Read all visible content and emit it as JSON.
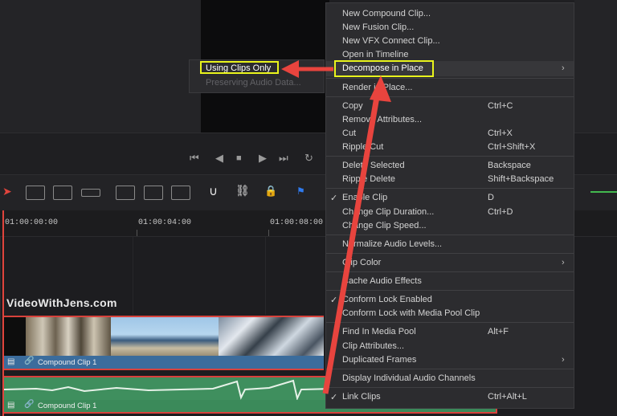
{
  "submenu": {
    "items": [
      "Using Clips Only",
      "Preserving Audio Data..."
    ]
  },
  "menu": {
    "items": [
      {
        "label": "New Compound Clip...",
        "shortcut": ""
      },
      {
        "label": "New Fusion Clip...",
        "shortcut": ""
      },
      {
        "label": "New VFX Connect Clip...",
        "shortcut": ""
      },
      {
        "label": "Open in Timeline",
        "shortcut": ""
      },
      {
        "label": "Decompose in Place",
        "shortcut": ""
      },
      {
        "label": "Render in Place...",
        "shortcut": ""
      },
      {
        "label": "Copy",
        "shortcut": "Ctrl+C"
      },
      {
        "label": "Remove Attributes...",
        "shortcut": ""
      },
      {
        "label": "Cut",
        "shortcut": "Ctrl+X"
      },
      {
        "label": "Ripple Cut",
        "shortcut": "Ctrl+Shift+X"
      },
      {
        "label": "Delete Selected",
        "shortcut": "Backspace"
      },
      {
        "label": "Ripple Delete",
        "shortcut": "Shift+Backspace"
      },
      {
        "label": "Enable Clip",
        "shortcut": "D"
      },
      {
        "label": "Change Clip Duration...",
        "shortcut": "Ctrl+D"
      },
      {
        "label": "Change Clip Speed...",
        "shortcut": ""
      },
      {
        "label": "Normalize Audio Levels...",
        "shortcut": ""
      },
      {
        "label": "Clip Color",
        "shortcut": ""
      },
      {
        "label": "Cache Audio Effects",
        "shortcut": ""
      },
      {
        "label": "Conform Lock Enabled",
        "shortcut": ""
      },
      {
        "label": "Conform Lock with Media Pool Clip",
        "shortcut": ""
      },
      {
        "label": "Find In Media Pool",
        "shortcut": "Alt+F"
      },
      {
        "label": "Clip Attributes...",
        "shortcut": ""
      },
      {
        "label": "Duplicated Frames",
        "shortcut": ""
      },
      {
        "label": "Display Individual Audio Channels",
        "shortcut": ""
      },
      {
        "label": "Link Clips",
        "shortcut": "Ctrl+Alt+L"
      }
    ]
  },
  "timeline": {
    "timecodes": [
      "01:00:00:00",
      "01:00:04:00",
      "01:00:08:00"
    ],
    "watermark": "VideoWithJens.com",
    "video_clip_label": "Compound Clip 1",
    "audio_clip_label": "Compound Clip 1"
  },
  "icons": {
    "transport": [
      "skip-to-start-icon",
      "play-reverse-icon",
      "stop-icon",
      "play-icon",
      "skip-to-end-icon",
      "loop-icon"
    ],
    "tools": [
      "selection-arrow-icon",
      "trim-edit-icon",
      "dynamic-trim-icon",
      "blade-icon",
      "insert-clip-icon",
      "overwrite-clip-icon",
      "replace-clip-icon",
      "snapping-icon",
      "linked-selection-icon",
      "position-lock-icon",
      "flag-icon"
    ]
  },
  "colors": {
    "highlight_box": "#e9f41c",
    "arrow": "#e8443e",
    "video_clip": "#3f6f9e",
    "audio_clip": "#3f8f5e",
    "menu_bg": "#2c2c2f"
  }
}
